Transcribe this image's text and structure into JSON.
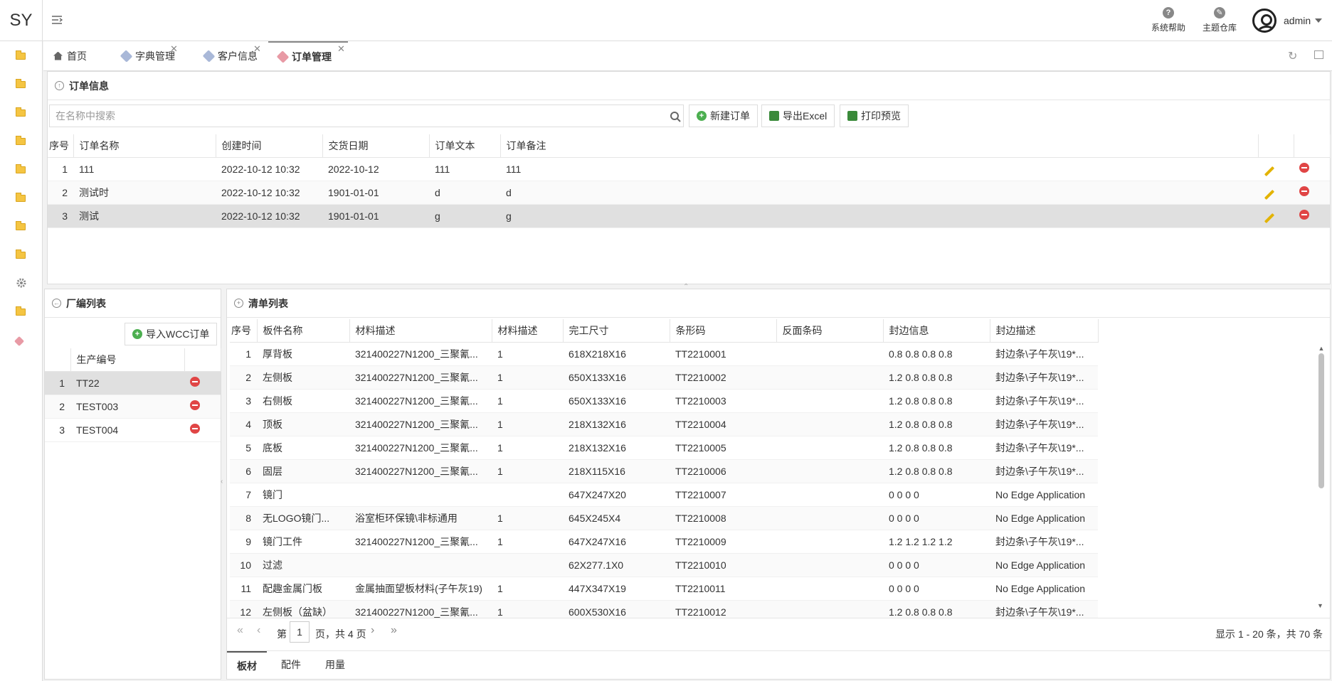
{
  "app": {
    "logo": "SY"
  },
  "topbar": {
    "help_label": "系统帮助",
    "theme_label": "主题仓库",
    "user_name": "admin"
  },
  "tabs": [
    {
      "label": "首页",
      "icon": "home-icon",
      "closable": false
    },
    {
      "label": "字典管理",
      "icon": "tag-icon",
      "closable": true
    },
    {
      "label": "客户信息",
      "icon": "tag-icon",
      "closable": true
    },
    {
      "label": "订单管理",
      "icon": "tag-icon",
      "closable": true,
      "active": true
    }
  ],
  "order_panel": {
    "title": "订单信息",
    "search_placeholder": "在名称中搜索",
    "buttons": {
      "new": "新建订单",
      "export": "导出Excel",
      "print": "打印预览"
    },
    "columns": [
      "序号",
      "订单名称",
      "创建时间",
      "交货日期",
      "订单文本",
      "订单备注"
    ],
    "rows": [
      {
        "no": "1",
        "name": "111",
        "created": "2022-10-12 10:32",
        "delivery": "2022-10-12",
        "text": "111",
        "note": "111"
      },
      {
        "no": "2",
        "name": "测试时",
        "created": "2022-10-12 10:32",
        "delivery": "1901-01-01",
        "text": "d",
        "note": "d"
      },
      {
        "no": "3",
        "name": "测试",
        "created": "2022-10-12 10:32",
        "delivery": "1901-01-01",
        "text": "g",
        "note": "g"
      }
    ]
  },
  "factory_panel": {
    "title": "厂编列表",
    "import_button": "导入WCC订单",
    "column": "生产编号",
    "rows": [
      {
        "no": "1",
        "code": "TT22"
      },
      {
        "no": "2",
        "code": "TEST003"
      },
      {
        "no": "3",
        "code": "TEST004"
      }
    ]
  },
  "list_panel": {
    "title": "清单列表",
    "columns": [
      "序号",
      "板件名称",
      "材料描述",
      "材料描述",
      "完工尺寸",
      "条形码",
      "反面条码",
      "封边信息",
      "封边描述"
    ],
    "rows": [
      {
        "no": "1",
        "name": "厚背板",
        "mat": "321400227N1200_三聚氰...",
        "mat2": "1",
        "size": "618X218X16",
        "barcode": "TT2210001",
        "back": "",
        "edge": "0.8 0.8 0.8 0.8",
        "edge_desc": "封边条\\子午灰\\19*..."
      },
      {
        "no": "2",
        "name": "左侧板",
        "mat": "321400227N1200_三聚氰...",
        "mat2": "1",
        "size": "650X133X16",
        "barcode": "TT2210002",
        "back": "",
        "edge": "1.2 0.8 0.8 0.8",
        "edge_desc": "封边条\\子午灰\\19*..."
      },
      {
        "no": "3",
        "name": "右侧板",
        "mat": "321400227N1200_三聚氰...",
        "mat2": "1",
        "size": "650X133X16",
        "barcode": "TT2210003",
        "back": "",
        "edge": "1.2 0.8 0.8 0.8",
        "edge_desc": "封边条\\子午灰\\19*..."
      },
      {
        "no": "4",
        "name": "顶板",
        "mat": "321400227N1200_三聚氰...",
        "mat2": "1",
        "size": "218X132X16",
        "barcode": "TT2210004",
        "back": "",
        "edge": "1.2 0.8 0.8 0.8",
        "edge_desc": "封边条\\子午灰\\19*..."
      },
      {
        "no": "5",
        "name": "底板",
        "mat": "321400227N1200_三聚氰...",
        "mat2": "1",
        "size": "218X132X16",
        "barcode": "TT2210005",
        "back": "",
        "edge": "1.2 0.8 0.8 0.8",
        "edge_desc": "封边条\\子午灰\\19*..."
      },
      {
        "no": "6",
        "name": "固层",
        "mat": "321400227N1200_三聚氰...",
        "mat2": "1",
        "size": "218X115X16",
        "barcode": "TT2210006",
        "back": "",
        "edge": "1.2 0.8 0.8 0.8",
        "edge_desc": "封边条\\子午灰\\19*..."
      },
      {
        "no": "7",
        "name": "镜门",
        "mat": "",
        "mat2": "",
        "size": "647X247X20",
        "barcode": "TT2210007",
        "back": "",
        "edge": "0 0 0 0",
        "edge_desc": "No Edge Application"
      },
      {
        "no": "8",
        "name": "无LOGO镜门...",
        "mat": "浴室柜环保镜\\非标通用",
        "mat2": "1",
        "size": "645X245X4",
        "barcode": "TT2210008",
        "back": "",
        "edge": "0 0 0 0",
        "edge_desc": "No Edge Application"
      },
      {
        "no": "9",
        "name": "镜门工件",
        "mat": "321400227N1200_三聚氰...",
        "mat2": "1",
        "size": "647X247X16",
        "barcode": "TT2210009",
        "back": "",
        "edge": "1.2 1.2 1.2 1.2",
        "edge_desc": "封边条\\子午灰\\19*..."
      },
      {
        "no": "10",
        "name": "过滤",
        "mat": "",
        "mat2": "",
        "size": "62X277.1X0",
        "barcode": "TT2210010",
        "back": "",
        "edge": "0 0 0 0",
        "edge_desc": "No Edge Application"
      },
      {
        "no": "11",
        "name": "配趣金属门板",
        "mat": "金属抽面望板材料(子午灰19)",
        "mat2": "1",
        "size": "447X347X19",
        "barcode": "TT2210011",
        "back": "",
        "edge": "0 0 0 0",
        "edge_desc": "No Edge Application"
      },
      {
        "no": "12",
        "name": "左侧板（盆缺）",
        "mat": "321400227N1200_三聚氰...",
        "mat2": "1",
        "size": "600X530X16",
        "barcode": "TT2210012",
        "back": "",
        "edge": "1.2 0.8 0.8 0.8",
        "edge_desc": "封边条\\子午灰\\19*..."
      }
    ],
    "pager": {
      "page_prefix": "第",
      "page": "1",
      "page_suffix": "页，共 4 页",
      "summary": "显示 1 - 20 条，共 70 条"
    },
    "bottom_tabs": [
      "板材",
      "配件",
      "用量"
    ]
  }
}
